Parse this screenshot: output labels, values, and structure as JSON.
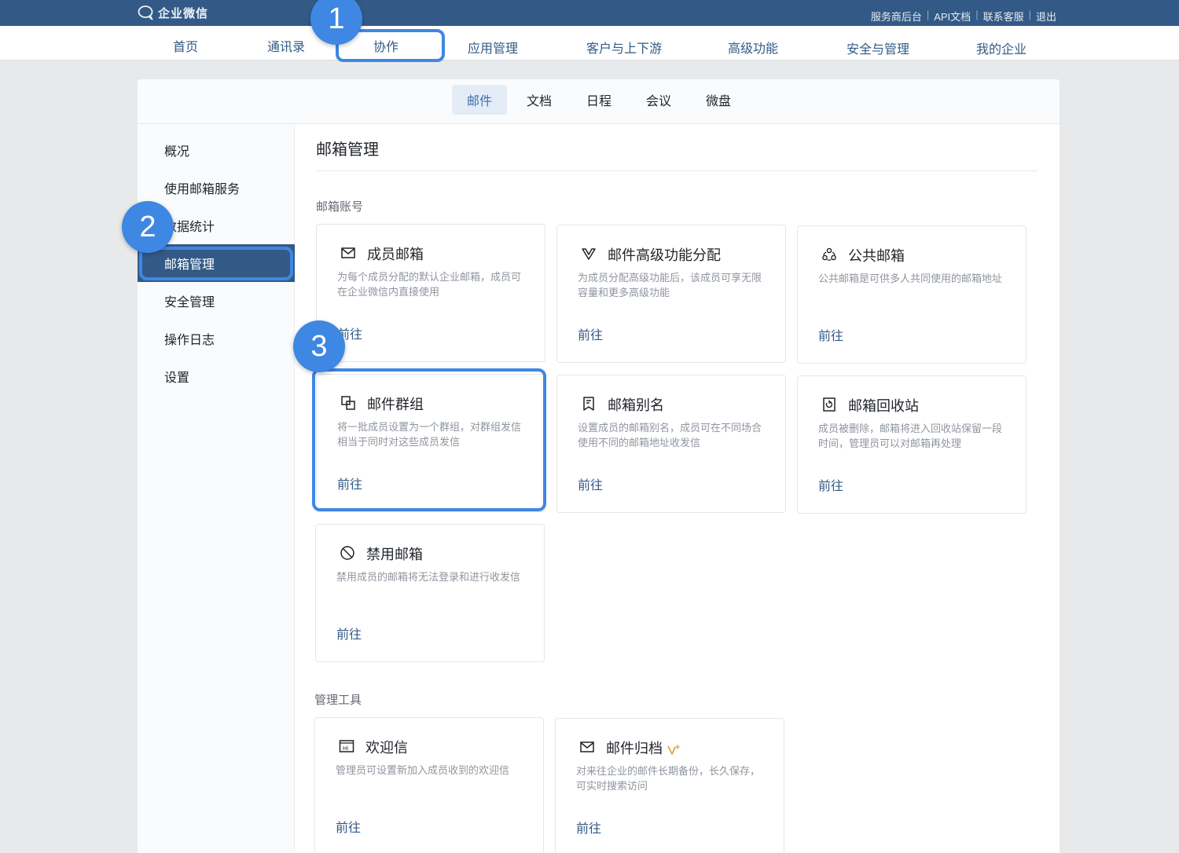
{
  "header": {
    "brand": "企业微信",
    "links": [
      "服务商后台",
      "API文档",
      "联系客服",
      "退出"
    ]
  },
  "main_nav": [
    {
      "label": "首页",
      "active": false
    },
    {
      "label": "通讯录",
      "active": false
    },
    {
      "label": "协作",
      "active": true
    },
    {
      "label": "应用管理",
      "active": false
    },
    {
      "label": "客户与上下游",
      "active": false
    },
    {
      "label": "高级功能",
      "active": false
    },
    {
      "label": "安全与管理",
      "active": false
    },
    {
      "label": "我的企业",
      "active": false
    }
  ],
  "sub_nav": [
    {
      "label": "邮件",
      "active": true
    },
    {
      "label": "文档",
      "active": false
    },
    {
      "label": "日程",
      "active": false
    },
    {
      "label": "会议",
      "active": false
    },
    {
      "label": "微盘",
      "active": false
    }
  ],
  "sidebar": {
    "items": [
      {
        "label": "概况",
        "active": false
      },
      {
        "label": "使用邮箱服务",
        "active": false
      },
      {
        "label": "数据统计",
        "active": false
      },
      {
        "label": "邮箱管理",
        "active": true
      },
      {
        "label": "安全管理",
        "active": false
      },
      {
        "label": "操作日志",
        "active": false
      },
      {
        "label": "设置",
        "active": false
      }
    ]
  },
  "content": {
    "title": "邮箱管理",
    "sections": [
      {
        "label": "邮箱账号",
        "cards": [
          {
            "title": "成员邮箱",
            "icon": "envelope-icon",
            "desc": "为每个成员分配的默认企业邮箱，成员可在企业微信内直接使用",
            "link": "前往"
          },
          {
            "title": "邮件高级功能分配",
            "icon": "v-badge-icon",
            "desc": "为成员分配高级功能后，该成员可享无限容量和更多高级功能",
            "link": "前往"
          },
          {
            "title": "公共邮箱",
            "icon": "group-icon",
            "desc": "公共邮箱是可供多人共同使用的邮箱地址",
            "link": "前往"
          },
          {
            "title": "邮件群组",
            "icon": "overlap-squares-icon",
            "desc": "将一批成员设置为一个群组，对群组发信相当于同时对这些成员发信",
            "link": "前往"
          },
          {
            "title": "邮箱别名",
            "icon": "bookmark-icon",
            "desc": "设置成员的邮箱别名，成员可在不同场合使用不同的邮箱地址收发信",
            "link": "前往"
          },
          {
            "title": "邮箱回收站",
            "icon": "recycle-bin-icon",
            "desc": "成员被删除，邮箱将进入回收站保留一段时间，管理员可以对邮箱再处理",
            "link": "前往"
          },
          {
            "title": "禁用邮箱",
            "icon": "ban-icon",
            "desc": "禁用成员的邮箱将无法登录和进行收发信",
            "link": "前往"
          }
        ]
      },
      {
        "label": "管理工具",
        "cards": [
          {
            "title": "欢迎信",
            "icon": "hi-card-icon",
            "desc": "管理员可设置新加入成员收到的欢迎信",
            "link": "前往"
          },
          {
            "title": "邮件归档",
            "icon": "envelope-icon",
            "desc": "对来往企业的邮件长期备份，长久保存，可实时搜索访问",
            "link": "前往"
          }
        ]
      }
    ]
  },
  "annotations": [
    "1",
    "2",
    "3"
  ],
  "colors": {
    "brand": "#335a86",
    "highlight": "#3f87e3",
    "muted_text": "#8f959e"
  }
}
